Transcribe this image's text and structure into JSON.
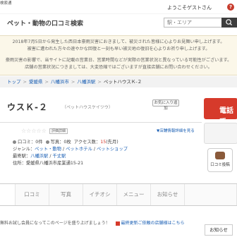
{
  "header": {
    "kicker": "検索通",
    "site_title": "ペット・動物の口コミ検索",
    "welcome": "ようこそゲストさん",
    "help_icon": "?",
    "area_placeholder": "駅・エリア"
  },
  "notice": {
    "line1": "2018年7月5日から発生した西日本豪雨災害におきまして、被災された皆様に心よりお見舞い申し上げます。",
    "line2": "被害に遭われた方々の速やかな回復と一刻も早い被災地の復旧を心よりお祈り申し上げます。",
    "line3": "豪雨災害の影響で、当サイトに記載の営業日、営業時間などが実際の営業状況と異なっている可能性がございます。",
    "line4": "店舗の営業状況につきましては、大変恐縮ではございますが直接店舗にお問い合わせください。"
  },
  "breadcrumb": {
    "items": [
      "トップ",
      "愛媛県",
      "八幡浜市",
      "八幡浜駅"
    ],
    "current": "ペットハウスＫ-２"
  },
  "shop": {
    "name": "ウスＫ-２",
    "kana": "（ペットハウスケイツウ）",
    "favorite_label": "お気に入り追加",
    "phone_label": "電話で",
    "rating_label": "評価詳細",
    "business_link": "▼店舗情報詳細を見る",
    "stars": "☆☆☆☆☆",
    "reviews_label": "口コミ：",
    "reviews_count": "0件",
    "photos_label": "写真：",
    "photos_count": "0枚",
    "access_label": "アクセス数：",
    "access_count": "15",
    "access_suffix": "(先月)",
    "genre_label": "ジャンル：",
    "genres": [
      "ペット・動物",
      "ペットホテル",
      "ペットショップ"
    ],
    "station_label": "最寄駅：",
    "stations": [
      "八幡浜駅",
      "千丈駅"
    ],
    "address_label": "住所：",
    "address": "愛媛県八幡浜市産業通15-21",
    "review_post_label": "口コミ投稿"
  },
  "tabs": [
    {
      "label": "",
      "active": true
    },
    {
      "label": "口コミ",
      "active": false
    },
    {
      "label": "写真",
      "active": false
    },
    {
      "label": "イチオシ",
      "active": false
    },
    {
      "label": "メニュー",
      "active": false
    },
    {
      "label": "お知らせ",
      "active": false
    },
    {
      "label": "",
      "active": false
    }
  ],
  "footer": {
    "note": "無料お試し会員になってこのページを盛り上げましょう！",
    "link": "最終更新ご依頼の店舗様はこちら",
    "oshirase": "お知らせ"
  },
  "colors": {
    "accent": "#d63a2b",
    "link": "#1a5fb4",
    "notice_bg": "#fbf7e9"
  }
}
